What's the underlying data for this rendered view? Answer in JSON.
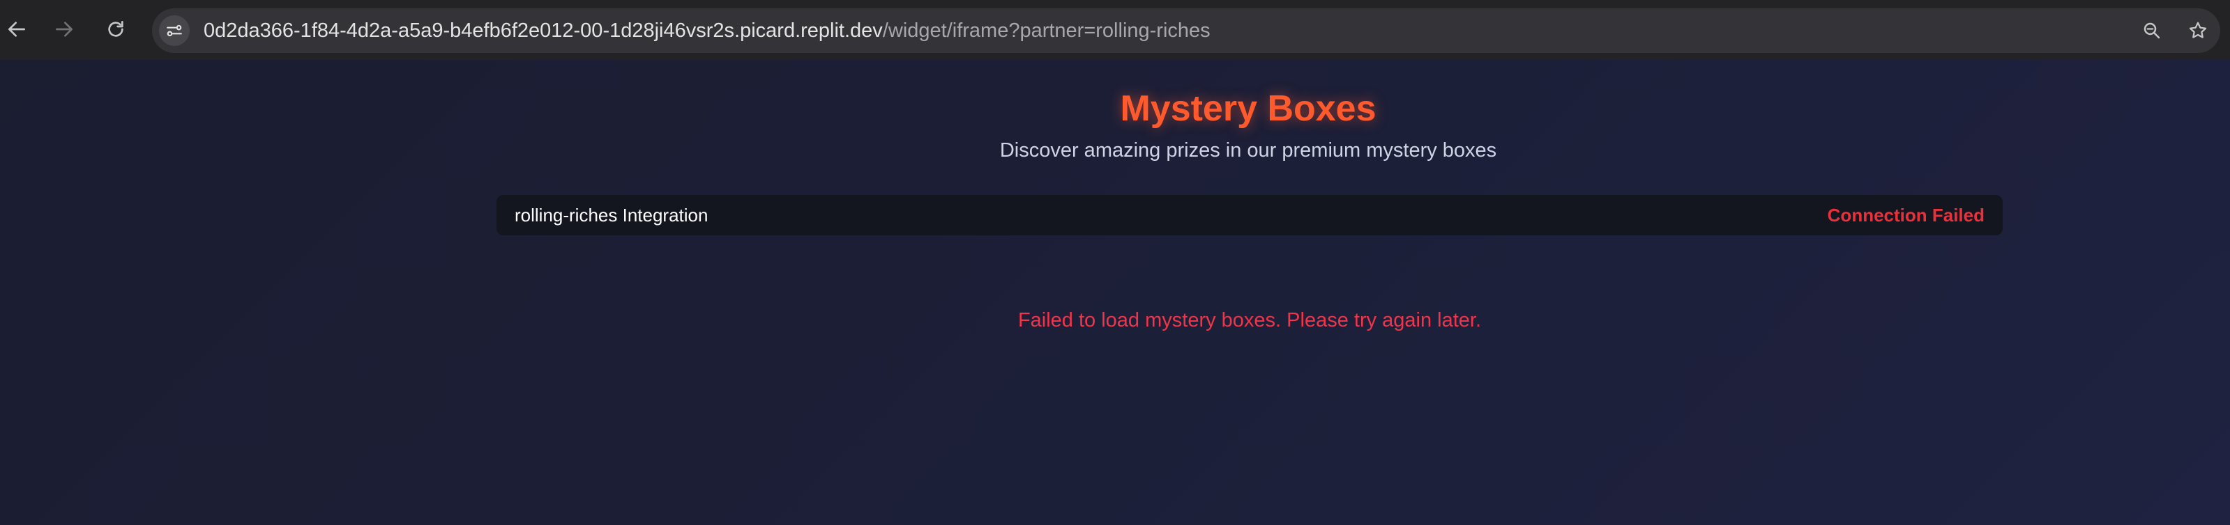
{
  "browser": {
    "url_host": "0d2da366-1f84-4d2a-a5a9-b4efb6f2e012-00-1d28ji46vsr2s.picard.replit.dev",
    "url_path": "/widget/iframe?partner=rolling-riches",
    "icons": [
      "back-arrow-icon",
      "forward-arrow-icon",
      "reload-icon",
      "site-info-icon",
      "zoom-icon",
      "bookmark-star-icon"
    ]
  },
  "page": {
    "title": "Mystery Boxes",
    "subtitle": "Discover amazing prizes in our premium mystery boxes",
    "integration_label": "rolling-riches Integration",
    "connection_status": "Connection Failed",
    "error_message": "Failed to load mystery boxes. Please try again later."
  },
  "colors": {
    "accent": "#ff5a2e",
    "error": "#e8313a",
    "background": "#191c31"
  }
}
